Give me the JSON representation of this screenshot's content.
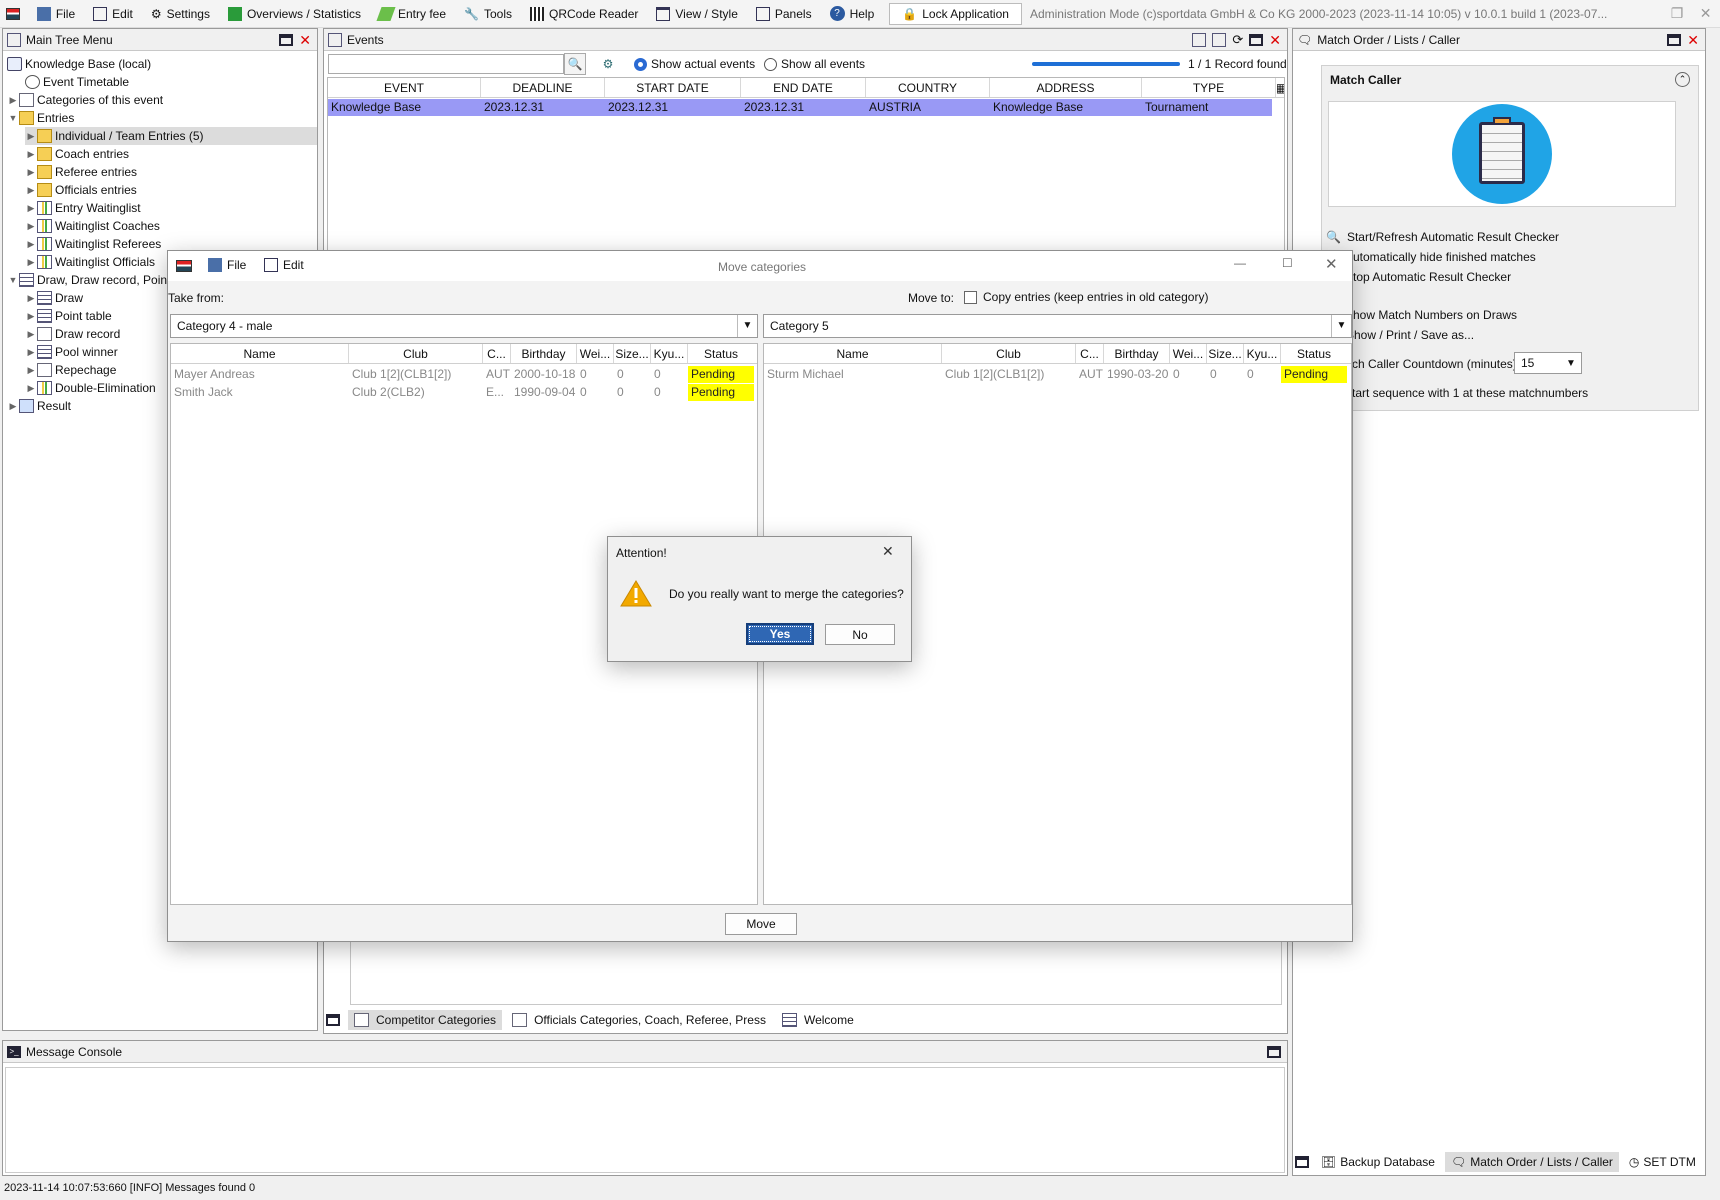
{
  "menubar": {
    "items": [
      "File",
      "Edit",
      "Settings",
      "Overviews / Statistics",
      "Entry fee",
      "Tools",
      "QRCode Reader",
      "View / Style",
      "Panels",
      "Help"
    ],
    "lock_label": "Lock Application",
    "title": "Administration Mode (c)sportdata GmbH & Co KG 2000-2023 (2023-11-14 10:05)  v 10.0.1 build 1 (2023-07..."
  },
  "tree": {
    "title": "Main Tree Menu",
    "items": [
      {
        "label": "Knowledge Base (local)"
      },
      {
        "label": "Event Timetable"
      },
      {
        "label": "Categories of this event"
      },
      {
        "label": "Entries"
      },
      {
        "label": "Individual / Team Entries (5)"
      },
      {
        "label": "Coach entries"
      },
      {
        "label": "Referee entries"
      },
      {
        "label": "Officials entries"
      },
      {
        "label": "Entry Waitinglist"
      },
      {
        "label": "Waitinglist Coaches"
      },
      {
        "label": "Waitinglist Referees"
      },
      {
        "label": "Waitinglist Officials"
      },
      {
        "label": "Draw, Draw record, Poin"
      },
      {
        "label": "Draw"
      },
      {
        "label": "Point table"
      },
      {
        "label": "Draw record"
      },
      {
        "label": "Pool winner"
      },
      {
        "label": "Repechage"
      },
      {
        "label": "Double-Elimination"
      },
      {
        "label": "Result"
      }
    ]
  },
  "events": {
    "title": "Events",
    "search_placeholder": "",
    "radio_actual": "Show actual events",
    "radio_all": "Show all events",
    "record_count": "1 / 1 Record found",
    "columns": [
      "EVENT",
      "DEADLINE",
      "START DATE",
      "END DATE",
      "COUNTRY",
      "ADDRESS",
      "TYPE"
    ],
    "rows": [
      [
        "Knowledge Base",
        "2023.12.31",
        "2023.12.31",
        "2023.12.31",
        "AUSTRIA",
        "Knowledge Base",
        "Tournament"
      ]
    ]
  },
  "bottom_tabs": [
    "Competitor Categories",
    "Officials Categories, Coach, Referee, Press",
    "Welcome"
  ],
  "console": {
    "title": "Message Console",
    "status": "2023-11-14 10:07:53:660 [INFO] Messages found 0"
  },
  "match_caller": {
    "panel_title": "Match Order / Lists / Caller",
    "section_title": "Match Caller",
    "options": [
      "Start/Refresh Automatic Result Checker",
      "Automatically hide finished matches",
      "Stop Automatic Result Checker",
      "Show Match Numbers on Draws",
      "Show / Print / Save as...",
      "Match Caller Countdown (minutes)",
      "Start sequence with 1 at these matchnumbers"
    ],
    "countdown_value": "15",
    "tabs": [
      "Backup Database",
      "Match Order / Lists / Caller",
      "SET DTM"
    ]
  },
  "move_dialog": {
    "title": "Move categories",
    "menu": [
      "File",
      "Edit"
    ],
    "take_from_label": "Take from:",
    "move_to_label": "Move to:",
    "copy_label": "Copy entries (keep entries in old category)",
    "from_category": "Category 4 - male",
    "to_category": "Category 5",
    "columns": [
      "Name",
      "Club",
      "C...",
      "Birthday",
      "Wei...",
      "Size...",
      "Kyu...",
      "Status"
    ],
    "left_rows": [
      [
        "Mayer Andreas",
        "Club 1[2](CLB1[2])",
        "AUT",
        "2000-10-18",
        "0",
        "0",
        "0",
        "Pending"
      ],
      [
        "Smith Jack",
        "Club 2(CLB2)",
        "E...",
        "1990-09-04",
        "0",
        "0",
        "0",
        "Pending"
      ]
    ],
    "right_rows": [
      [
        "Sturm Michael",
        "Club 1[2](CLB1[2])",
        "AUT",
        "1990-03-20",
        "0",
        "0",
        "0",
        "Pending"
      ]
    ],
    "move_button": "Move"
  },
  "confirm": {
    "title": "Attention!",
    "message": "Do you really want to merge the categories?",
    "yes": "Yes",
    "no": "No"
  }
}
